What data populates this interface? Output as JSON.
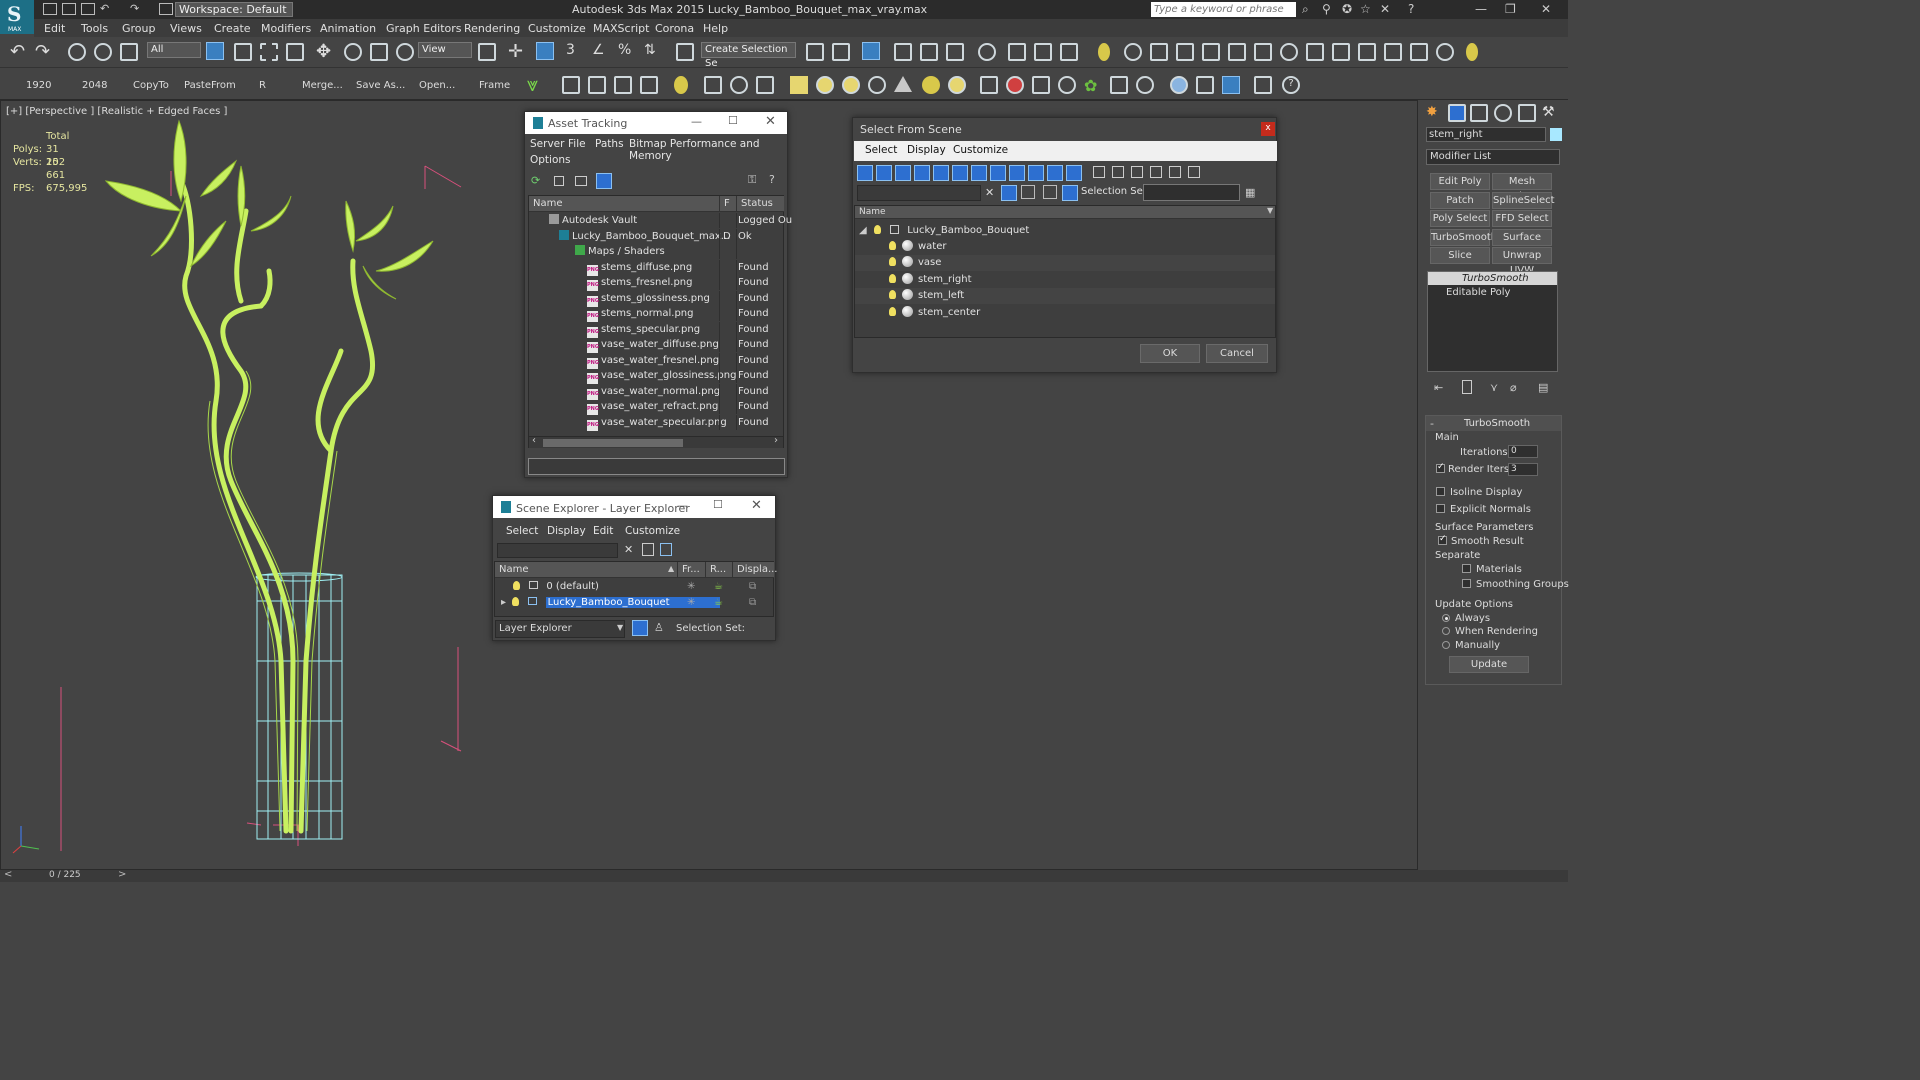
{
  "app": {
    "title": "Autodesk 3ds Max  2015    Lucky_Bamboo_Bouquet_max_vray.max",
    "logo_text": "MAX",
    "workspace_label": "Workspace: Default",
    "search_placeholder": "Type a keyword or phrase"
  },
  "menu": [
    "Edit",
    "Tools",
    "Group",
    "Views",
    "Create",
    "Modifiers",
    "Animation",
    "Graph Editors",
    "Rendering",
    "Customize",
    "MAXScript",
    "Corona",
    "Help"
  ],
  "toolbar1": {
    "filter_value": "All",
    "view_value": "View",
    "selection_set_value": "Create Selection Se"
  },
  "toolbar2": {
    "labels": [
      "1920",
      "2048",
      "CopyTo",
      "PasteFrom",
      "R",
      "Merge...",
      "Save As...",
      "Open...",
      "Frame"
    ]
  },
  "viewport": {
    "label": "[+] [Perspective ] [Realistic + Edged Faces ]",
    "stats": {
      "total_label": "Total",
      "polys_label": "Polys:",
      "polys_value": "31 202",
      "verts_label": "Verts:",
      "verts_value": "15 661",
      "fps_label": "FPS:",
      "fps_value": "675,995"
    }
  },
  "asset_tracking": {
    "title": "Asset Tracking",
    "menu": [
      "Server",
      "File",
      "Paths",
      "Bitmap Performance and Memory"
    ],
    "menu2": "Options",
    "col_name": "Name",
    "col_f": "F",
    "col_status": "Status",
    "rows": [
      {
        "name": "Autodesk Vault",
        "f": "",
        "status": "Logged Ou"
      },
      {
        "name": "Lucky_Bamboo_Bouquet_max...",
        "f": "D",
        "status": "Ok"
      },
      {
        "name": "Maps / Shaders",
        "f": "",
        "status": ""
      },
      {
        "name": "stems_diffuse.png",
        "f": "",
        "status": "Found"
      },
      {
        "name": "stems_fresnel.png",
        "f": "",
        "status": "Found"
      },
      {
        "name": "stems_glossiness.png",
        "f": "",
        "status": "Found"
      },
      {
        "name": "stems_normal.png",
        "f": "",
        "status": "Found"
      },
      {
        "name": "stems_specular.png",
        "f": "",
        "status": "Found"
      },
      {
        "name": "vase_water_diffuse.png",
        "f": "",
        "status": "Found"
      },
      {
        "name": "vase_water_fresnel.png",
        "f": "",
        "status": "Found"
      },
      {
        "name": "vase_water_glossiness.png",
        "f": "",
        "status": "Found"
      },
      {
        "name": "vase_water_normal.png",
        "f": "",
        "status": "Found"
      },
      {
        "name": "vase_water_refract.png",
        "f": "",
        "status": "Found"
      },
      {
        "name": "vase_water_specular.png",
        "f": "",
        "status": "Found"
      }
    ],
    "png_tag": "PNG"
  },
  "select_from_scene": {
    "title": "Select From Scene",
    "menu": [
      "Select",
      "Display",
      "Customize"
    ],
    "selection_set_label": "Selection Set:",
    "col_name": "Name",
    "root": "Lucky_Bamboo_Bouquet",
    "children": [
      "water",
      "vase",
      "stem_right",
      "stem_left",
      "stem_center"
    ],
    "ok": "OK",
    "cancel": "Cancel",
    "close": "x"
  },
  "scene_explorer": {
    "title": "Scene Explorer - Layer Explorer",
    "menu": [
      "Select",
      "Display",
      "Edit",
      "Customize"
    ],
    "col_name": "Name",
    "col_fr": "Fr...",
    "col_r": "R...",
    "col_disp": "Displa...",
    "layers": [
      "0 (default)",
      "Lucky_Bamboo_Bouquet"
    ],
    "footer_dropdown": "Layer Explorer",
    "selection_set_label": "Selection Set:"
  },
  "command_panel": {
    "object_name": "stem_right",
    "modifier_list": "Modifier List",
    "buttons": [
      "Edit Poly",
      "Mesh Select",
      "Patch Select",
      "SplineSelect",
      "Poly Select",
      "FFD Select",
      "TurboSmooth",
      "Surface Select",
      "Slice",
      "Unwrap UVW"
    ],
    "stack": [
      "TurboSmooth",
      "Editable Poly"
    ],
    "rollout_title": "TurboSmooth",
    "main_label": "Main",
    "iterations_label": "Iterations:",
    "iterations_value": "0",
    "render_iters_label": "Render Iters:",
    "render_iters_value": "3",
    "render_iters_checked": true,
    "isoline_label": "Isoline Display",
    "explicit_label": "Explicit Normals",
    "surface_params_label": "Surface Parameters",
    "smooth_result_label": "Smooth Result",
    "separate_label": "Separate",
    "materials_label": "Materials",
    "smoothing_groups_label": "Smoothing Groups",
    "update_options_label": "Update Options",
    "always_label": "Always",
    "when_rendering_label": "When Rendering",
    "manually_label": "Manually",
    "update_button": "Update"
  },
  "statusbar": {
    "frame": "0 / 225"
  },
  "colors": {
    "accent_blue": "#2d6fd0",
    "bamboo": "#c8f060",
    "vase": "#9ff0f4",
    "bounding": "#e0507a"
  }
}
